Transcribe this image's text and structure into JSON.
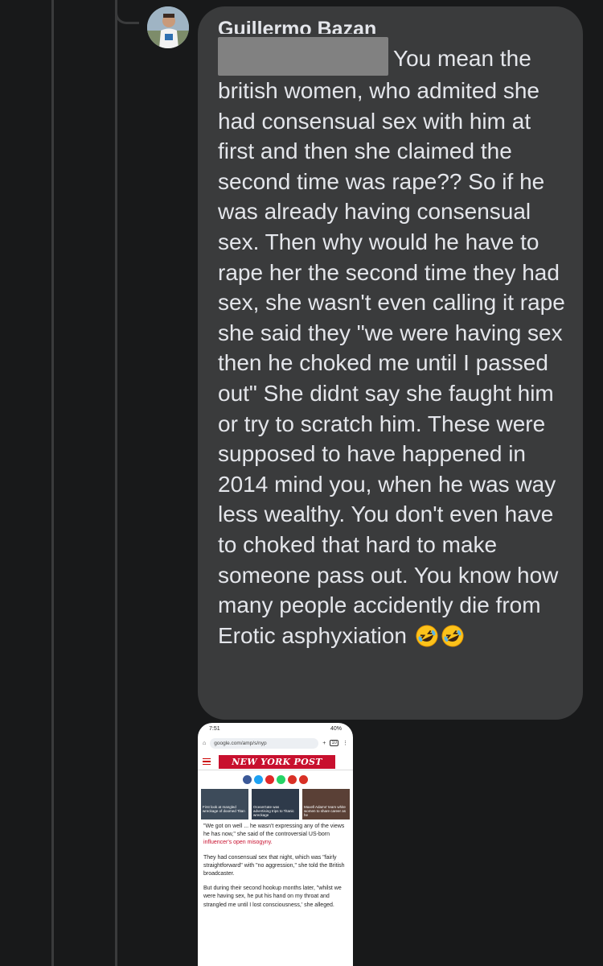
{
  "comment": {
    "author": "Guillermo Bazan",
    "text": "You mean the british women, who admited she had consensual sex with him at first and then she claimed the second time was rape?? So if he was already having consensual sex. Then why would he have to rape her the second time they had sex, she wasn't even calling it rape she said they \"we were having sex then he choked me until I passed out\" She didnt say she faught him or try to scratch him. These were supposed to have happened in 2014 mind you, when he was way less wealthy. You don't even have to choked that hard to make someone pass out. You know how many people accidently die from Erotic asphyxiation",
    "emoji_icons": [
      "rolling-on-floor-laughing-icon",
      "rolling-on-floor-laughing-icon"
    ]
  },
  "screenshot": {
    "status_time": "7:51",
    "status_battery": "40%",
    "url": "google.com/amp/s/nyp",
    "tab_count": "10",
    "logo": "NEW YORK POST",
    "thumbs": [
      {
        "caption": "First look at mangled wreckage of doomed Titan",
        "color": "#3d4b5a"
      },
      {
        "caption": "OceanGate was advertising trips to Titanic wreckage",
        "color": "#2e3a4a"
      },
      {
        "caption": "Maxell Adams' team white women to share career as he",
        "color": "#5a4036"
      }
    ],
    "paragraph_1_pre": "\"We got on well ... he wasn't expressing any of the views he has now,\" she said of the controversial US-born ",
    "paragraph_1_link": "influencer's open misogyny.",
    "paragraph_2": "They had consensual sex that night, which was \"fairly straightforward\" with \"no aggression,\" she told the British broadcaster.",
    "paragraph_3": "But during their second hookup months later, \"whilst we were having sex, he put his hand on my throat and strangled me until I lost consciousness,' she alleged."
  }
}
